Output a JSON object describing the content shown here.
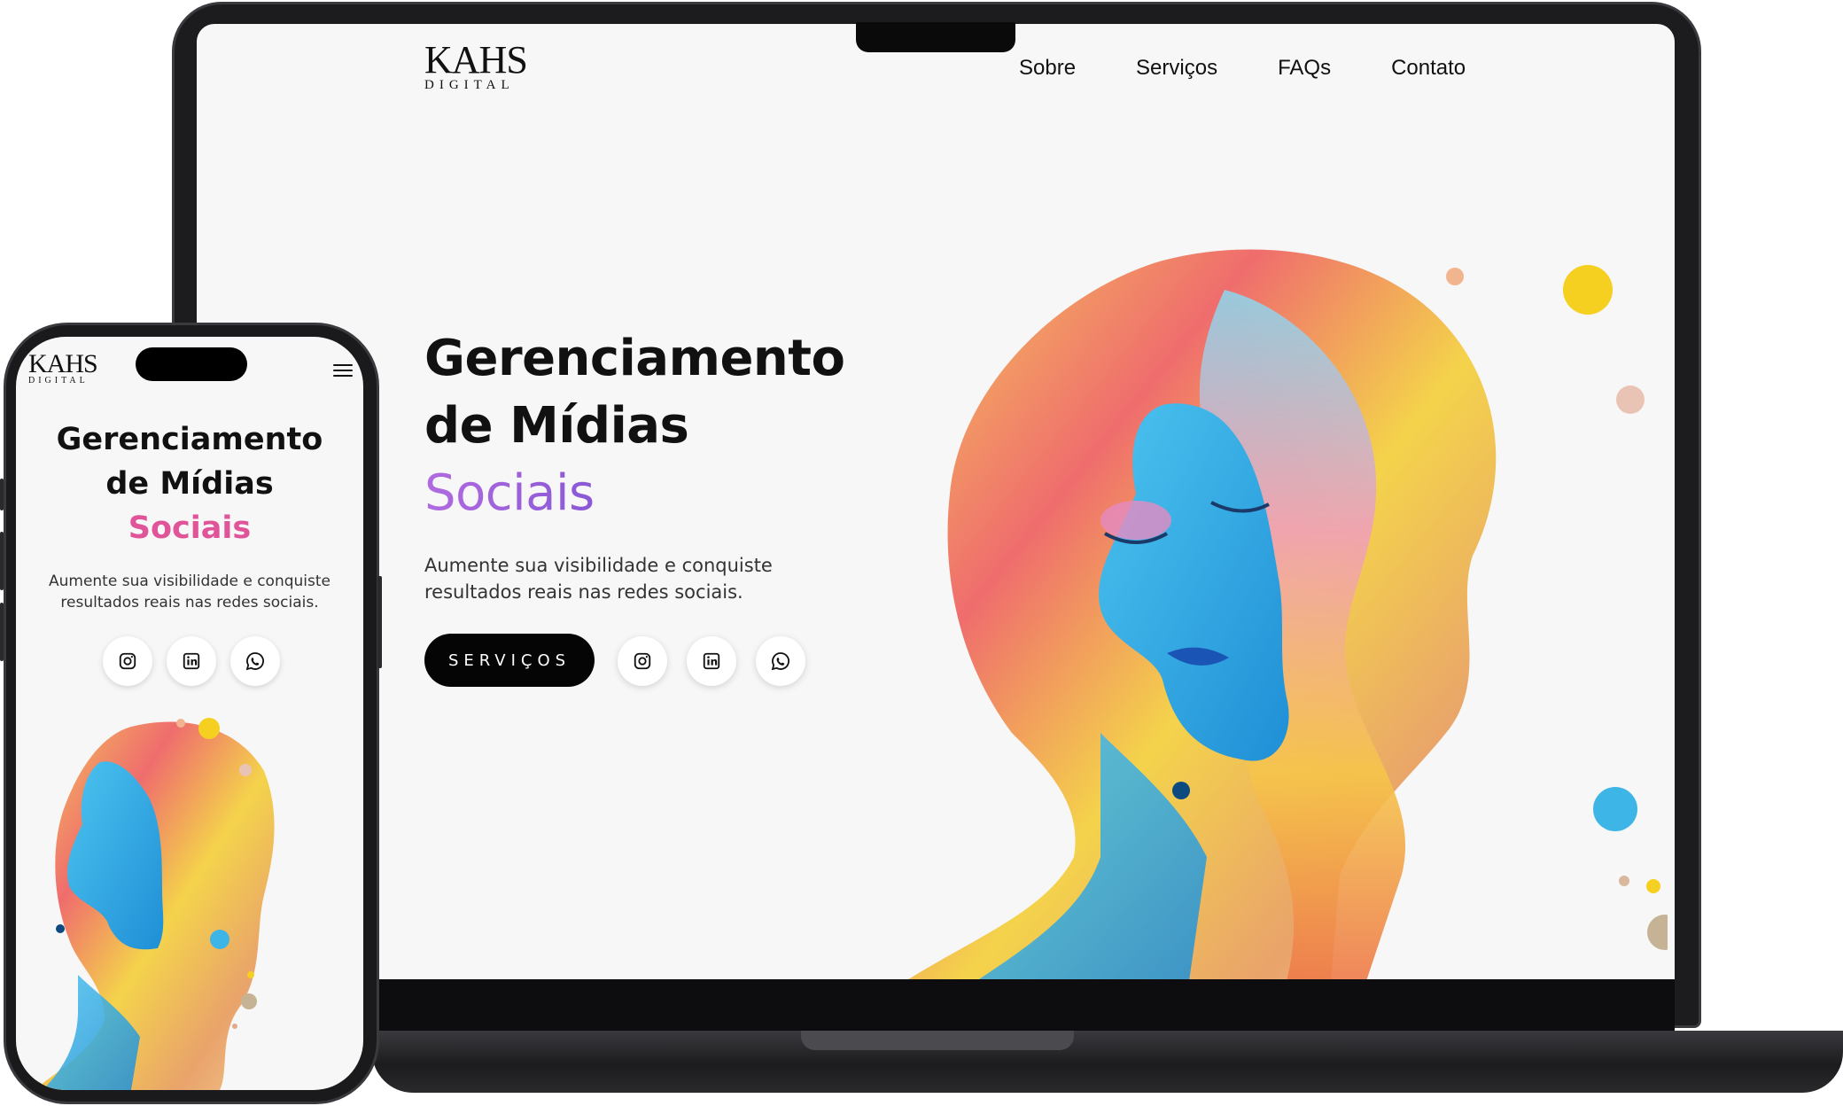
{
  "brand": {
    "logo_main": "KAHS",
    "logo_sub": "DIGITAL"
  },
  "nav": {
    "items": [
      "Sobre",
      "Serviços",
      "FAQs",
      "Contato"
    ]
  },
  "hero": {
    "title_line1": "Gerenciamento",
    "title_line2": "de Mídias",
    "title_accent": "Sociais",
    "description": "Aumente sua visibilidade e conquiste resultados reais nas redes sociais.",
    "cta_label": "SERVIÇOS"
  },
  "social": [
    "instagram-icon",
    "linkedin-icon",
    "whatsapp-icon"
  ],
  "colors": {
    "accent_desktop": "#a965dc",
    "accent_mobile": "#e0559a",
    "cta_bg": "#050505",
    "page_bg": "#f7f7f7"
  }
}
